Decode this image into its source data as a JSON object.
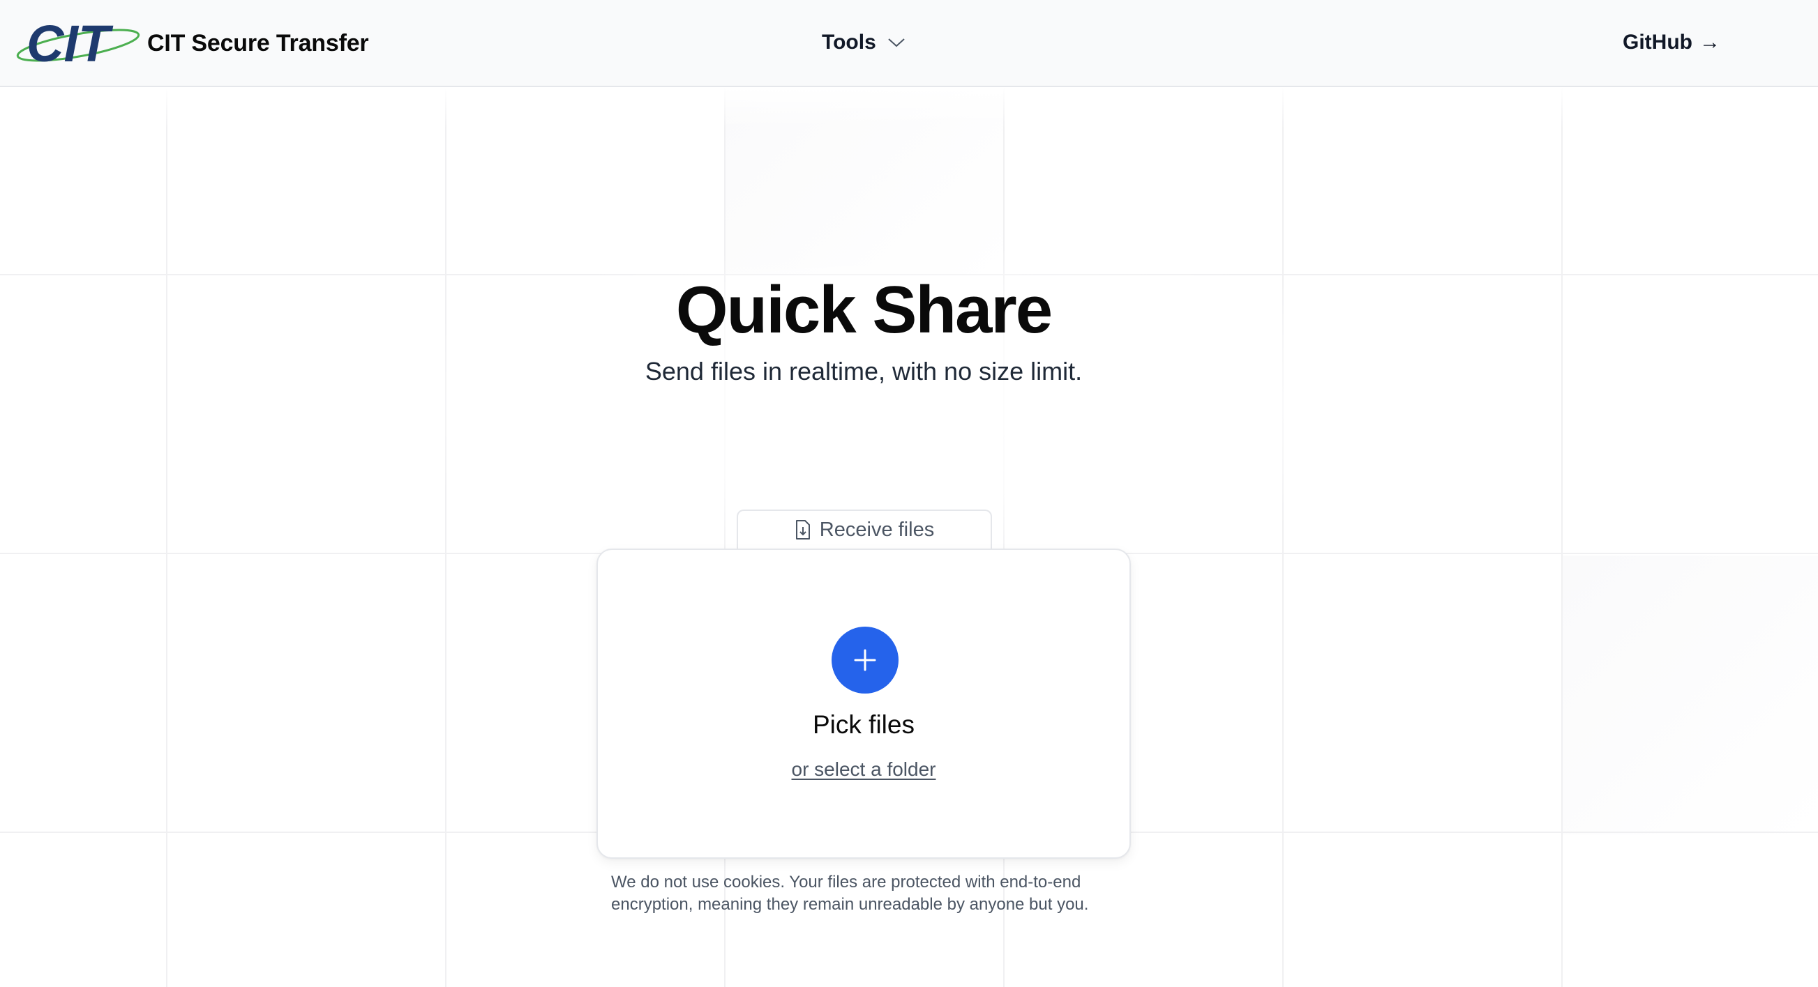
{
  "header": {
    "brand": {
      "logo_text": "CIT",
      "name": "CIT Secure Transfer"
    },
    "nav": {
      "tools_label": "Tools",
      "github_label": "GitHub",
      "github_arrow": "→"
    }
  },
  "hero": {
    "title": "Quick Share",
    "subtitle": "Send files in realtime, with no size limit."
  },
  "receive_tab": {
    "label": "Receive files",
    "icon": "file-download-icon"
  },
  "dropzone": {
    "button_icon": "plus-icon",
    "pick_label": "Pick files",
    "folder_link": "or select a folder"
  },
  "privacy": {
    "line1": "We do not use cookies. Your files are protected with end-to-end",
    "line2": "encryption, meaning they remain unreadable by anyone but you."
  },
  "colors": {
    "accent": "#2563eb",
    "logo_blue": "#1e3a6e",
    "logo_green": "#4caf50",
    "header_bg": "#f9fafb"
  }
}
